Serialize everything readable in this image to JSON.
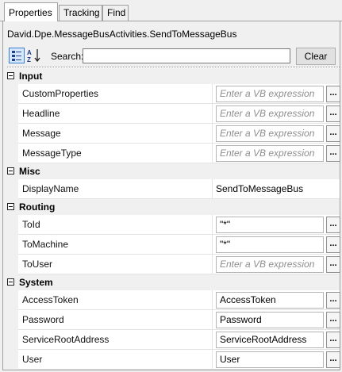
{
  "tabs": [
    {
      "label": "Properties"
    },
    {
      "label": "Tracking"
    },
    {
      "label": "Find"
    }
  ],
  "activity_title": "David.Dpe.MessageBusActivities.SendToMessageBus",
  "toolbar": {
    "categorized_icon": "categorized-icon",
    "alphabetical_icon": "sort-alpha-icon",
    "search_label": "Search:",
    "search_value": "",
    "clear_label": "Clear"
  },
  "categories": [
    {
      "name": "Input",
      "properties": [
        {
          "name": "CustomProperties",
          "value": "Enter a VB expression",
          "placeholder": true
        },
        {
          "name": "Headline",
          "value": "Enter a VB expression",
          "placeholder": true
        },
        {
          "name": "Message",
          "value": "Enter a VB expression",
          "placeholder": true
        },
        {
          "name": "MessageType",
          "value": "Enter a VB expression",
          "placeholder": true
        }
      ]
    },
    {
      "name": "Misc",
      "properties": [
        {
          "name": "DisplayName",
          "value": "SendToMessageBus"
        }
      ]
    },
    {
      "name": "Routing",
      "properties": [
        {
          "name": "ToId",
          "value": "\"*\""
        },
        {
          "name": "ToMachine",
          "value": "\"*\""
        },
        {
          "name": "ToUser",
          "value": "Enter a VB expression",
          "placeholder": true
        }
      ]
    },
    {
      "name": "System",
      "properties": [
        {
          "name": "AccessToken",
          "value": "AccessToken"
        },
        {
          "name": "Password",
          "value": "Password"
        },
        {
          "name": "ServiceRootAddress",
          "value": "ServiceRootAddress"
        },
        {
          "name": "User",
          "value": "User"
        }
      ]
    }
  ],
  "ellipsis_label": "...",
  "colors": {
    "accent": "#3a7dd1",
    "placeholder": "#8e8e8e",
    "panel_bg": "#f0f0f0"
  }
}
